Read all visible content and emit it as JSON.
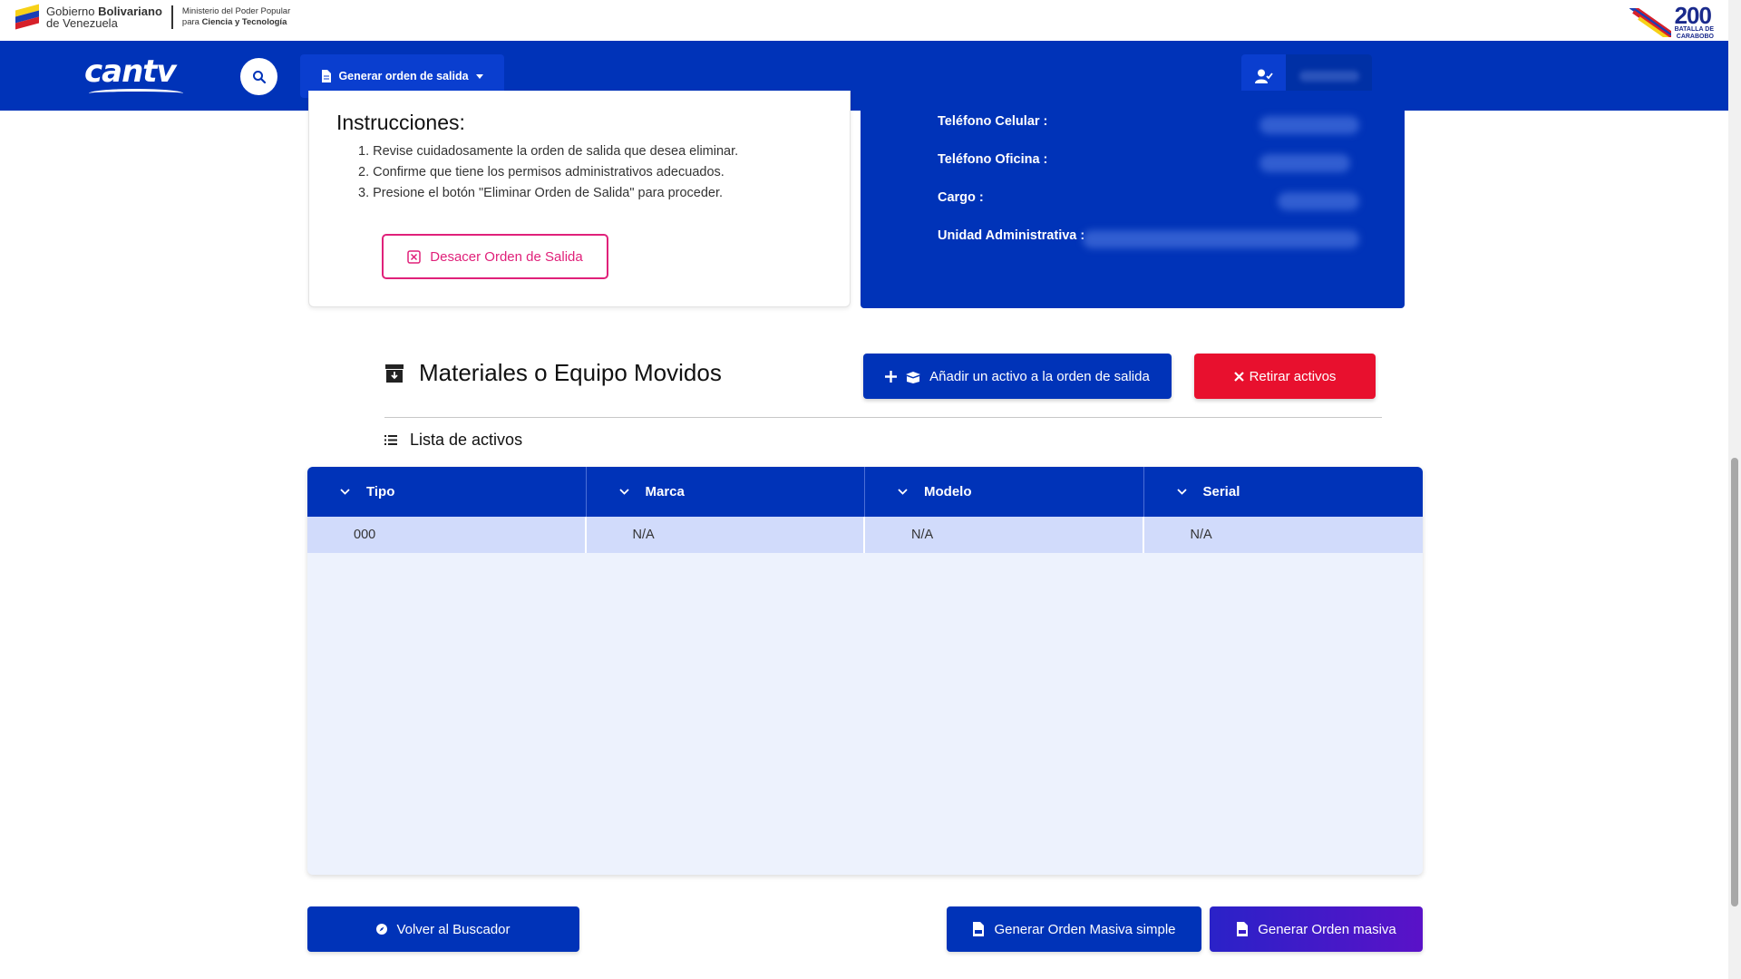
{
  "gov_header": {
    "gov_line1": "Gobierno",
    "gov_line1_bold": "Bolivariano",
    "gov_line2": "de Venezuela",
    "ministry_line1": "Ministerio del Poder Popular",
    "ministry_line2_prefix": "para",
    "ministry_line2_bold": "Ciencia y Tecnología",
    "bicentennial_number": "200",
    "bicentennial_line1": "BATALLA DE",
    "bicentennial_line2": "CARABOBO"
  },
  "navbar": {
    "logo_text": "cantv",
    "menu_label": "Generar orden de salida",
    "search_icon": "search-icon",
    "user_icon": "user-check-icon"
  },
  "instructions": {
    "title": "Instrucciones:",
    "steps": [
      "1. Revise cuidadosamente la orden de salida que desea eliminar.",
      "2. Confirme que tiene los permisos administrativos adecuados.",
      "3. Presione el botón \"Eliminar Orden de Salida\" para proceder."
    ],
    "undo_button": "Desacer Orden de Salida"
  },
  "user_info": {
    "phone_mobile_label": "Teléfono Celular :",
    "phone_office_label": "Teléfono Oficina :",
    "position_label": "Cargo :",
    "admin_unit_label": "Unidad Administrativa :"
  },
  "materials": {
    "title": "Materiales o Equipo Movidos",
    "add_button": "Añadir un activo a la orden de salida",
    "remove_button": "Retirar activos",
    "list_title": "Lista de activos"
  },
  "table": {
    "columns": [
      "Tipo",
      "Marca",
      "Modelo",
      "Serial"
    ],
    "rows": [
      [
        "000",
        "N/A",
        "N/A",
        "N/A"
      ]
    ]
  },
  "footer_buttons": {
    "back": "Volver al Buscador",
    "simple": "Generar Orden Masiva simple",
    "masiva": "Generar Orden masiva"
  },
  "colors": {
    "primary": "#0033b8",
    "danger": "#e8102e",
    "accent_pink": "#e0217a"
  }
}
